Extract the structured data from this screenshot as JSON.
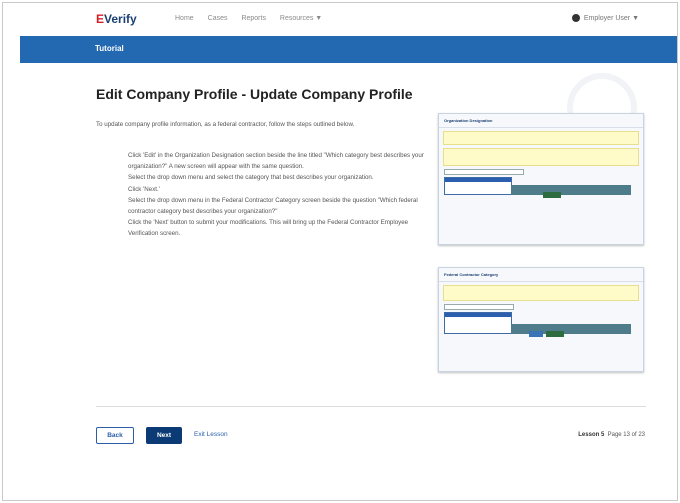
{
  "header": {
    "logo_prefix": "E",
    "logo_text": "Verify",
    "nav": [
      "Home",
      "Cases",
      "Reports",
      "Resources ▼"
    ],
    "user": "Employer User ▼"
  },
  "tutorial_label": "Tutorial",
  "page_title": "Edit Company Profile - Update Company Profile",
  "intro": "To update company profile information, as a federal contractor, follow the steps outlined below.",
  "steps": [
    "Click 'Edit' in the Organization Designation section beside the line titled \"Which category best describes your organization?\" A new screen will appear with the same question.",
    "Select the drop down menu and select the category that best describes your organization.",
    "Click 'Next.'",
    "Select the drop down menu in the Federal Contractor Category screen beside the question \"Which federal contractor category best describes your organization?\"",
    "Click the 'Next' button to submit your modifications. This will bring up the Federal Contractor Employee Verification screen."
  ],
  "screenshot1": {
    "title": "Organization Designation"
  },
  "screenshot2": {
    "title": "Federal Contractor Category"
  },
  "footer": {
    "back": "Back",
    "next": "Next",
    "exit": "Exit Lesson",
    "lesson": "Lesson 5",
    "page": "Page 13 of 23"
  },
  "colors": {
    "brand_blue": "#2369b2",
    "navy": "#0c3a74",
    "logo_red": "#d21f27"
  }
}
